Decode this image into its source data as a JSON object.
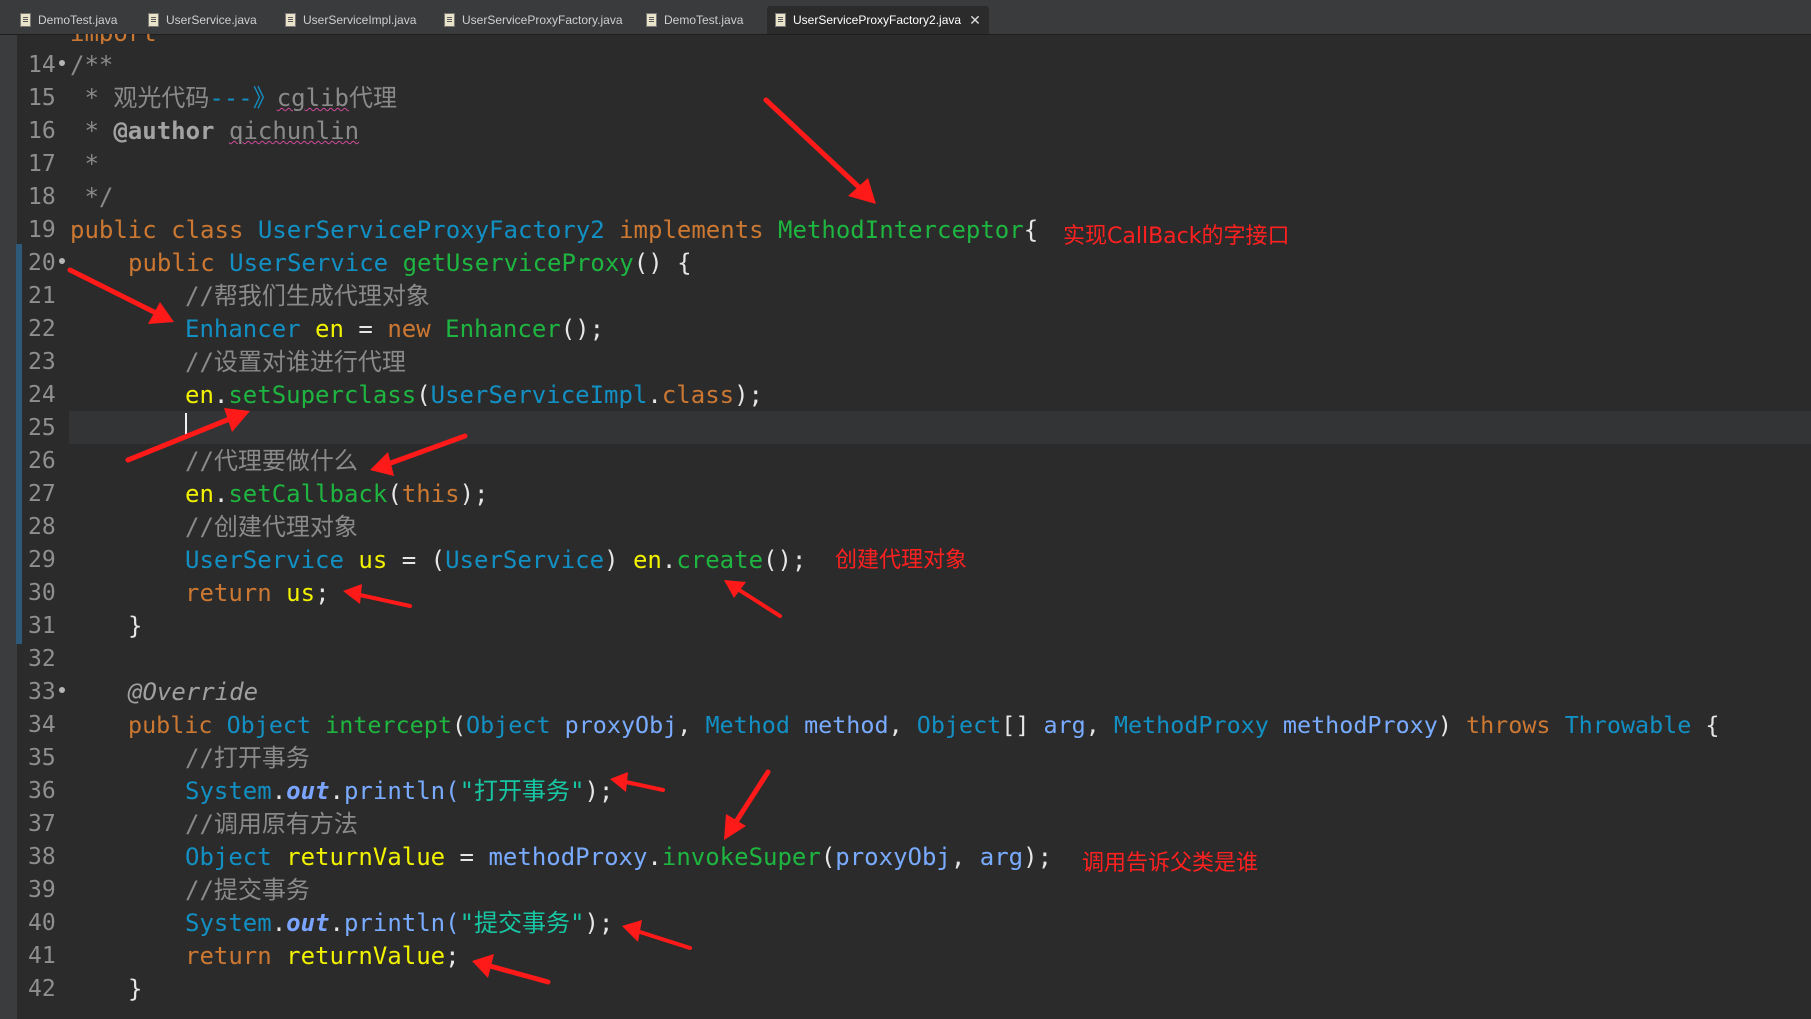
{
  "tabs": [
    {
      "label": "DemoTest.java",
      "active": false
    },
    {
      "label": "UserService.java",
      "active": false
    },
    {
      "label": "UserServiceImpl.java",
      "active": false
    },
    {
      "label": "UserServiceProxyFactory.java",
      "active": false
    },
    {
      "label": "DemoTest.java",
      "active": false
    },
    {
      "label": "UserServiceProxyFactory2.java",
      "active": true
    }
  ],
  "tab_close_glyph": "✕",
  "lines": [
    {
      "n": "14",
      "fold": true
    },
    {
      "n": "15"
    },
    {
      "n": "16"
    },
    {
      "n": "17"
    },
    {
      "n": "18"
    },
    {
      "n": "19"
    },
    {
      "n": "20",
      "fold": true
    },
    {
      "n": "21"
    },
    {
      "n": "22"
    },
    {
      "n": "23"
    },
    {
      "n": "24"
    },
    {
      "n": "25"
    },
    {
      "n": "26"
    },
    {
      "n": "27"
    },
    {
      "n": "28"
    },
    {
      "n": "29"
    },
    {
      "n": "30"
    },
    {
      "n": "31"
    },
    {
      "n": "32"
    },
    {
      "n": "33",
      "fold": true
    },
    {
      "n": "34"
    },
    {
      "n": "35"
    },
    {
      "n": "36"
    },
    {
      "n": "37"
    },
    {
      "n": "38"
    },
    {
      "n": "39"
    },
    {
      "n": "40"
    },
    {
      "n": "41"
    },
    {
      "n": "42"
    }
  ],
  "code": {
    "top_partial": "import ",
    "l14": "/**",
    "l15_star": " * ",
    "l15_text": "观光代码",
    "l15_dash": "---》",
    "l15_cglib": "cglib",
    "l15_tail": "代理",
    "l16_star": " * ",
    "l16_tag": "@author",
    "l16_name": "qichunlin",
    "l17": " *",
    "l18": " */",
    "l19_public": "public",
    "l19_class": "class",
    "l19_name": "UserServiceProxyFactory2",
    "l19_impl": "implements",
    "l19_iface": "MethodInterceptor",
    "l19_brace": "{",
    "l20_public": "public",
    "l20_type": "UserService",
    "l20_method": "getUserviceProxy",
    "l20_rest": "() {",
    "l21": "//帮我们生成代理对象",
    "l22_type": "Enhancer",
    "l22_var": "en",
    "l22_eq": " = ",
    "l22_new": "new",
    "l22_ctor": "Enhancer",
    "l22_end": "();",
    "l23": "//设置对谁进行代理",
    "l24_var": "en",
    "l24_dot": ".",
    "l24_method": "setSuperclass",
    "l24_open": "(",
    "l24_type": "UserServiceImpl",
    "l24_dot2": ".",
    "l24_class": "class",
    "l24_end": ");",
    "l26": "//代理要做什么",
    "l27_var": "en",
    "l27_dot": ".",
    "l27_method": "setCallback",
    "l27_open": "(",
    "l27_this": "this",
    "l27_end": ");",
    "l28": "//创建代理对象",
    "l29_type": "UserService",
    "l29_var": "us",
    "l29_eq": " = (",
    "l29_cast": "UserService",
    "l29_close": ") ",
    "l29_en": "en",
    "l29_dot": ".",
    "l29_method": "create",
    "l29_end": "();",
    "l30_return": "return",
    "l30_var": "us",
    "l30_end": ";",
    "l31": "}",
    "l33": "@Override",
    "l34_public": "public",
    "l34_type": "Object",
    "l34_method": "intercept",
    "l34_open": "(",
    "l34_t1": "Object",
    "l34_p1": "proxyObj",
    "l34_c1": ", ",
    "l34_t2": "Method",
    "l34_p2": "method",
    "l34_c2": ", ",
    "l34_t3": "Object",
    "l34_arr": "[] ",
    "l34_p3": "arg",
    "l34_c3": ", ",
    "l34_t4": "MethodProxy",
    "l34_p4": "methodProxy",
    "l34_close": ") ",
    "l34_throws": "throws",
    "l34_thr": "Throwable",
    "l34_brace": " {",
    "l35": "//打开事务",
    "l36_sys": "System",
    "l36_dot": ".",
    "l36_out": "out",
    "l36_dot2": ".",
    "l36_m": "println(",
    "l36_str": "\"打开事务\"",
    "l36_end": ");",
    "l37": "//调用原有方法",
    "l38_type": "Object",
    "l38_var": "returnValue",
    "l38_eq": " = ",
    "l38_mp": "methodProxy",
    "l38_dot": ".",
    "l38_method": "invokeSuper",
    "l38_open": "(",
    "l38_p1": "proxyObj",
    "l38_c": ", ",
    "l38_p2": "arg",
    "l38_end": ");",
    "l39": "//提交事务",
    "l40_sys": "System",
    "l40_dot": ".",
    "l40_out": "out",
    "l40_dot2": ".",
    "l40_m": "println(",
    "l40_str": "\"提交事务\"",
    "l40_end": ");",
    "l41_return": "return",
    "l41_var": "returnValue",
    "l41_end": ";",
    "l42": "}"
  },
  "annotations": {
    "callback_note": "实现CallBack的字接口",
    "create_note": "创建代理对象",
    "super_note": "调用告诉父类是谁"
  },
  "colors": {
    "keyword": "#cc7832",
    "type": "#1290c3",
    "method": "#1eb540",
    "variable": "#f2f200",
    "comment": "#8a8a8a",
    "string": "#17c6a3",
    "annotation_red": "#ff2020"
  }
}
